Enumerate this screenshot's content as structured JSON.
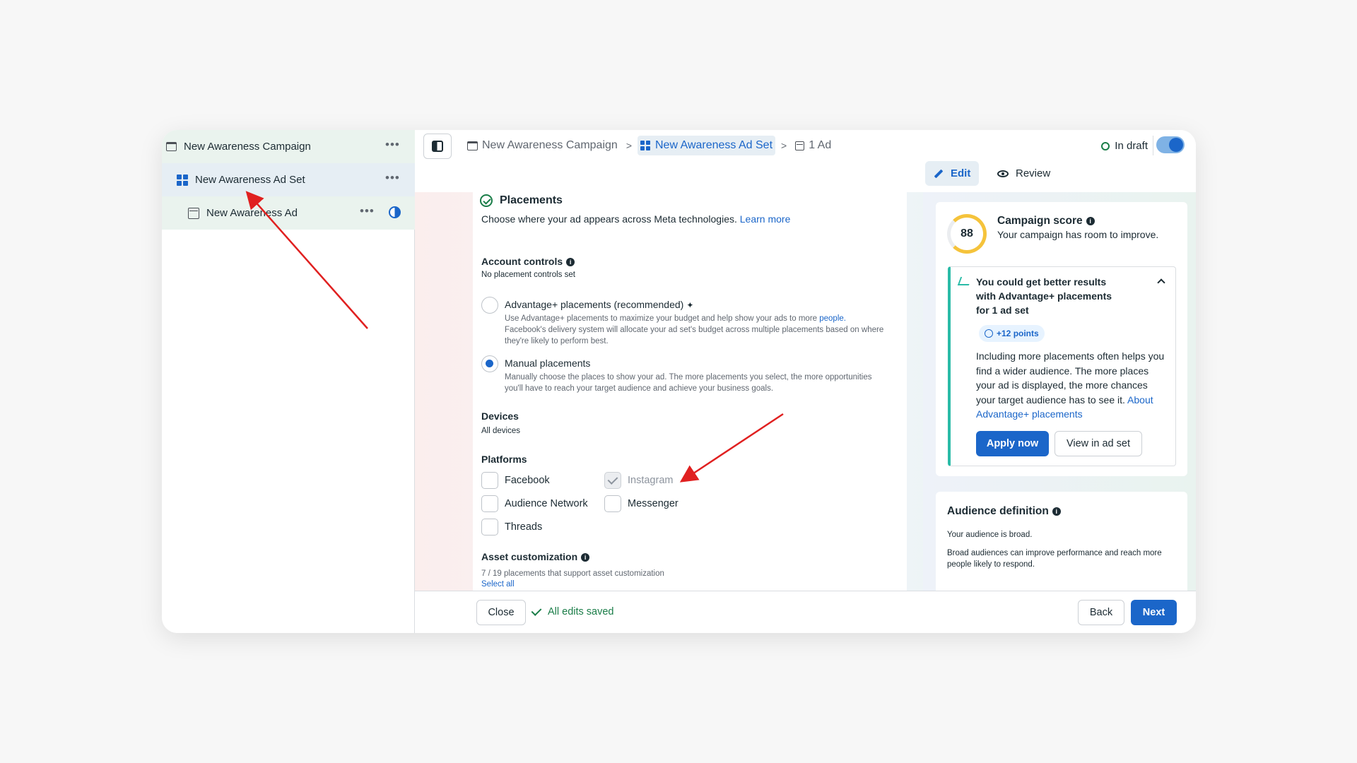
{
  "sidebar": {
    "campaign_label": "New Awareness Campaign",
    "adset_label": "New Awareness Ad Set",
    "ad_label": "New Awareness Ad",
    "more": "•••"
  },
  "breadcrumb": {
    "campaign": "New Awareness Campaign",
    "adset": "New Awareness Ad Set",
    "ad": "1 Ad",
    "sep": ">"
  },
  "status": {
    "label": "In draft"
  },
  "tabs": {
    "edit": "Edit",
    "review": "Review"
  },
  "placements": {
    "title": "Placements",
    "description": "Choose where your ad appears across Meta technologies.",
    "learn_more": "Learn more",
    "account_controls_title": "Account controls",
    "account_controls_sub": "No placement controls set",
    "advantage_label": "Advantage+ placements (recommended)",
    "advantage_desc_1": "Use Advantage+ placements to maximize your budget and help show your ads to more ",
    "advantage_desc_link": "people.",
    "advantage_desc_2": "Facebook's delivery system will allocate your ad set's budget across multiple placements based on where they're likely to perform best.",
    "manual_label": "Manual placements",
    "manual_desc": "Manually choose the places to show your ad. The more placements you select, the more opportunities you'll have to reach your target audience and achieve your business goals.",
    "devices_title": "Devices",
    "devices_value": "All devices",
    "platforms_title": "Platforms",
    "platforms": {
      "facebook": "Facebook",
      "instagram": "Instagram",
      "audience_network": "Audience Network",
      "messenger": "Messenger",
      "threads": "Threads"
    },
    "asset_title": "Asset customization",
    "asset_sub": "7 / 19 placements that support asset customization",
    "select_all": "Select all"
  },
  "score": {
    "value": "88",
    "title": "Campaign score",
    "subtitle": "Your campaign has room to improve.",
    "tip_title": "You could get better results with Advantage+ placements for 1 ad set",
    "points": "+12 points",
    "tip_body": "Including more placements often helps you find a wider audience. The more places your ad is displayed, the more chances your target audience has to see it.",
    "tip_link": "About Advantage+ placements",
    "apply_label": "Apply now",
    "view_label": "View in ad set"
  },
  "audience": {
    "title": "Audience definition",
    "line1": "Your audience is broad.",
    "line2": "Broad audiences can improve performance and reach more people likely to respond."
  },
  "footer": {
    "close_label": "Close",
    "saved_label": "All edits saved",
    "back_label": "Back",
    "next_label": "Next"
  },
  "colors": {
    "accent": "#1b66c9",
    "success": "#1a7d48",
    "annotation_arrow": "#e02020"
  },
  "icons": [
    "folder-icon",
    "grid-icon",
    "ad-icon",
    "more-icon",
    "contrast-icon",
    "panel-toggle-icon",
    "edit-pencil-icon",
    "eye-icon",
    "check-circle-icon",
    "info-icon",
    "sparkle-icon",
    "trend-icon",
    "chevron-up-icon",
    "checkmark-icon"
  ]
}
